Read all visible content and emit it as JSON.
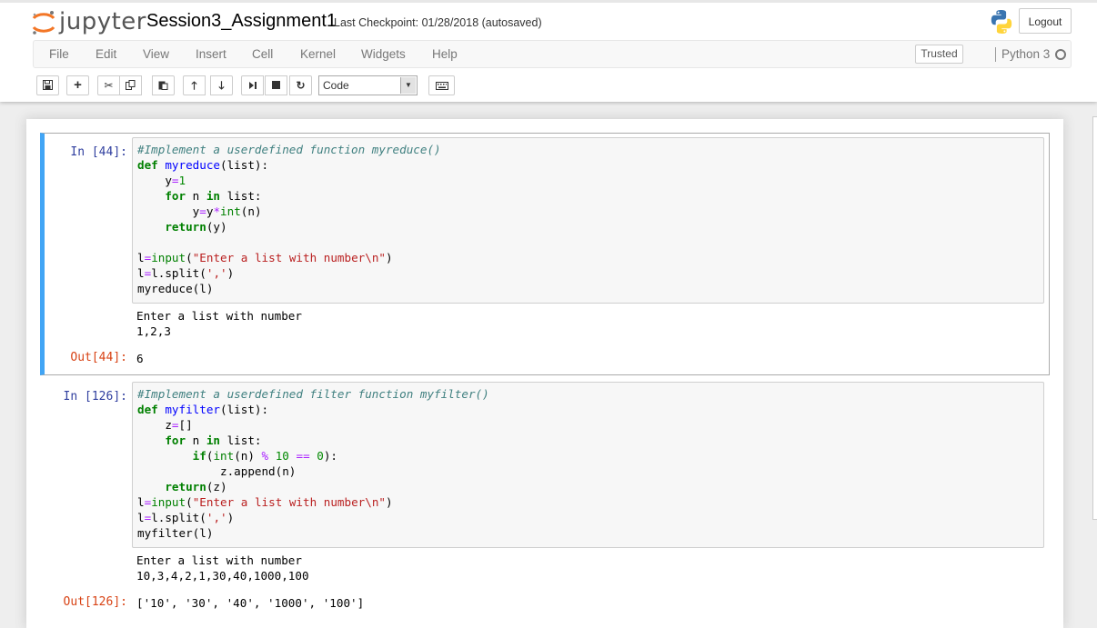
{
  "header": {
    "logo_text": "jupyter",
    "notebook_title": "Session3_Assignment1",
    "checkpoint": "Last Checkpoint: 01/28/2018 (autosaved)",
    "logout_label": "Logout"
  },
  "menubar": {
    "items": [
      "File",
      "Edit",
      "View",
      "Insert",
      "Cell",
      "Kernel",
      "Widgets",
      "Help"
    ],
    "trusted_label": "Trusted",
    "kernel_name": "Python 3"
  },
  "toolbar": {
    "buttons": [
      "save-icon",
      "plus-icon",
      "cut-icon",
      "copy-icon",
      "paste-icon",
      "arrow-up-icon",
      "arrow-down-icon",
      "step-forward-icon",
      "stop-icon",
      "refresh-icon",
      "keyboard-icon"
    ],
    "cell_type": "Code"
  },
  "cells": [
    {
      "in_prompt": "In [44]:",
      "source_lines": [
        "#Implement a userdefined function myreduce()",
        "def myreduce(list):",
        "    y=1",
        "    for n in list:",
        "        y=y*int(n)",
        "    return(y)",
        "",
        "l=input(\"Enter a list with number\\n\")",
        "l=l.split(',')",
        "myreduce(l)"
      ],
      "stdout": "Enter a list with number\n1,2,3",
      "out_prompt": "Out[44]:",
      "output": "6"
    },
    {
      "in_prompt": "In [126]:",
      "source_lines": [
        "#Implement a userdefined filter function myfilter()",
        "def myfilter(list):",
        "    z=[]",
        "    for n in list:",
        "        if(int(n) % 10 == 0):",
        "            z.append(n)",
        "    return(z)",
        "l=input(\"Enter a list with number\\n\")",
        "l=l.split(',')",
        "myfilter(l)"
      ],
      "stdout": "Enter a list with number\n10,3,4,2,1,30,40,1000,100",
      "out_prompt": "Out[126]:",
      "output": "['10', '30', '40', '1000', '100']"
    }
  ]
}
